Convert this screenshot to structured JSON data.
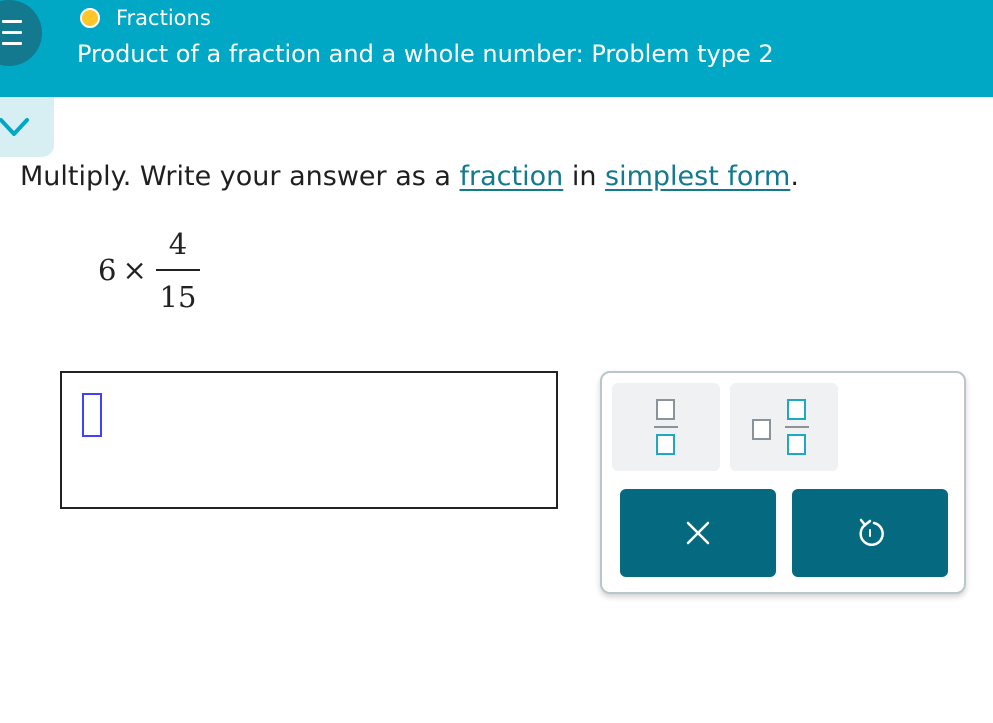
{
  "header": {
    "topic": "Fractions",
    "title": "Product of a fraction and a whole number: Problem type 2",
    "topic_status_color": "#ffc629",
    "icons": {
      "menu": "hamburger-menu-icon",
      "collapse": "chevron-down-icon"
    }
  },
  "question": {
    "instruction_prefix": "Multiply. Write your answer as a ",
    "link_fraction": "fraction",
    "instruction_mid": " in ",
    "link_simplest_form": "simplest form",
    "instruction_suffix": ".",
    "whole": "6",
    "operator": "×",
    "numerator": "4",
    "denominator": "15"
  },
  "answer": {
    "value": ""
  },
  "keypad": {
    "buttons": [
      "fraction-template-icon",
      "mixed-number-template-icon",
      "clear-x-icon",
      "undo-icon"
    ]
  },
  "colors": {
    "header": "#00a8c6",
    "accent_dark": "#056a80",
    "link": "#12798f",
    "template_blue": "#1fa8c2",
    "cursor": "#4040ff"
  }
}
